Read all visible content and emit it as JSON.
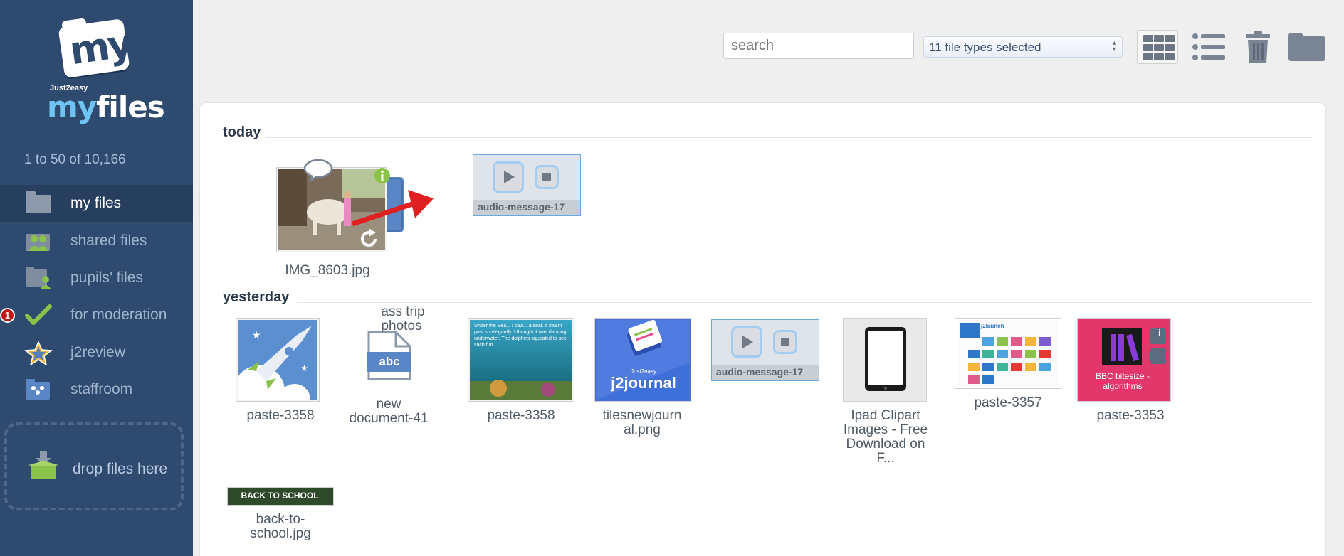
{
  "sidebar": {
    "logo": {
      "badge_text": "my",
      "sub_text": "Just2easy",
      "name_my": "my",
      "name_files": "files"
    },
    "count_label": "1 to 50 of 10,166",
    "items": [
      {
        "label": "my files",
        "icon": "folder-icon"
      },
      {
        "label": "shared files",
        "icon": "shared-people-icon"
      },
      {
        "label": "pupils’ files",
        "icon": "pupils-folder-icon"
      },
      {
        "label": "for moderation",
        "icon": "checkmark-icon",
        "badge": "1"
      },
      {
        "label": "j2review",
        "icon": "star-icon"
      },
      {
        "label": "staffroom",
        "icon": "staffroom-folder-icon"
      }
    ],
    "drop_label": "drop files here"
  },
  "toolbar": {
    "search_placeholder": "search",
    "file_types_value": "11 file types selected"
  },
  "sections": {
    "today": {
      "title": "today",
      "files": [
        {
          "name": "IMG_8603.jpg",
          "type": "image"
        },
        {
          "name": "class trip photos",
          "name_visible_line1": "ass trip",
          "name_visible_line2": "photos",
          "type": "folder"
        },
        {
          "name": "audio-message-17",
          "type": "audio"
        }
      ]
    },
    "yesterday": {
      "title": "yesterday",
      "files": [
        {
          "name": "paste-3358",
          "type": "image"
        },
        {
          "name_line1": "new",
          "name_line2": "document-41",
          "type": "document",
          "icon_text": "abc"
        },
        {
          "name": "paste-3358",
          "type": "image",
          "thumb_text": "Under the Sea... I saw... a seal. It swam past so elegantly. I thought it was dancing underwater. The dolphins squealed to see such fun."
        },
        {
          "name_line1": "tilesnewjourn",
          "name_line2": "al.png",
          "type": "image",
          "thumb_text_small": "Just2easy",
          "thumb_text": "j2journal"
        },
        {
          "name": "audio-message-17",
          "type": "audio"
        },
        {
          "name_line1": "Ipad Clipart",
          "name_line2": "Images - Free",
          "name_line3": "Download on",
          "name_line4": "F...",
          "type": "image"
        },
        {
          "name": "paste-3357",
          "type": "image",
          "thumb_text": "j2launch"
        },
        {
          "name": "paste-3353",
          "type": "image",
          "thumb_text_line1": "BBC bitesize -",
          "thumb_text_line2": "algorithms"
        },
        {
          "name_line1": "back-to-",
          "name_line2": "school.jpg",
          "type": "image",
          "thumb_text": "BACK TO SCHOOL"
        }
      ]
    }
  },
  "colors": {
    "sidebar": "#2e4a6e",
    "sidebar_active": "#263f5f",
    "accent_blue": "#5b86c5",
    "badge_red": "#c01818",
    "green": "#8bc34a"
  }
}
